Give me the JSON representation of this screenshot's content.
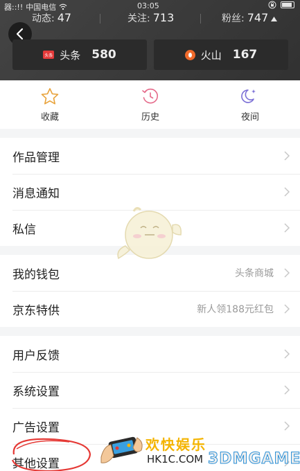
{
  "status_bar": {
    "signal_text": "器::!!",
    "carrier": "中国电信",
    "time": "03:05"
  },
  "profile_stats": {
    "dynamics_label": "动态:",
    "dynamics_count": "47",
    "following_label": "关注:",
    "following_count": "713",
    "fans_label": "粉丝:",
    "fans_count": "747"
  },
  "platforms": [
    {
      "label": "头条",
      "count": "580",
      "icon": "toutiao-icon",
      "icon_text": "头条"
    },
    {
      "label": "火山",
      "count": "167",
      "icon": "huoshan-icon"
    }
  ],
  "quick_actions": [
    {
      "label": "收藏",
      "icon": "star-icon"
    },
    {
      "label": "历史",
      "icon": "history-clock-icon"
    },
    {
      "label": "夜间",
      "icon": "moon-icon"
    }
  ],
  "menu_groups": [
    [
      {
        "label": "作品管理",
        "value": ""
      },
      {
        "label": "消息通知",
        "value": ""
      },
      {
        "label": "私信",
        "value": ""
      }
    ],
    [
      {
        "label": "我的钱包",
        "value": "头条商城"
      },
      {
        "label": "京东特供",
        "value": "新人领188元红包"
      }
    ],
    [
      {
        "label": "用户反馈",
        "value": ""
      },
      {
        "label": "系统设置",
        "value": ""
      },
      {
        "label": "广告设置",
        "value": ""
      },
      {
        "label": "其他设置",
        "value": ""
      }
    ]
  ],
  "watermark": {
    "cn_text": "欢快娱乐",
    "site": "HK1C.COM",
    "brand": "3DMGAME"
  },
  "colors": {
    "header_bg": "#3a3a3a",
    "accent_red": "#e43a3a",
    "icon_purple": "#7b6fd6",
    "icon_orange": "#e8a23a",
    "icon_pink": "#e56a8a"
  }
}
